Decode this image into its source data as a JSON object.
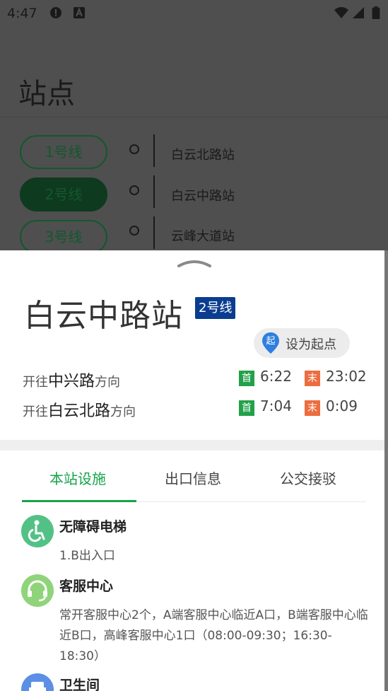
{
  "status_bar": {
    "time": "4:47"
  },
  "background": {
    "title": "站点",
    "lines": [
      {
        "label": "1号线",
        "active": false
      },
      {
        "label": "2号线",
        "active": true
      },
      {
        "label": "3号线",
        "active": false
      }
    ],
    "stations": [
      "白云北路站",
      "白云中路站",
      "云峰大道站"
    ]
  },
  "sheet": {
    "station_name": "白云中路站",
    "line_badge": "2号线",
    "set_start": {
      "pin": "起",
      "label": "设为起点"
    },
    "directions": [
      {
        "prefix": "开往",
        "dest": "中兴路",
        "suffix": "方向",
        "first_label": "首",
        "first_time": "6:22",
        "last_label": "末",
        "last_time": "23:02"
      },
      {
        "prefix": "开往",
        "dest": "白云北路",
        "suffix": "方向",
        "first_label": "首",
        "first_time": "7:04",
        "last_label": "末",
        "last_time": "0:09"
      }
    ],
    "tabs": [
      "本站设施",
      "出口信息",
      "公交接驳"
    ],
    "facilities": [
      {
        "title": "无障碍电梯",
        "desc": "1.B出入口",
        "icon": "wheelchair-icon",
        "color": "#53c185"
      },
      {
        "title": "客服中心",
        "desc": "常开客服中心2个，A端客服中心临近A口，B端客服中心临近B口，高峰客服中心1口（08:00-09:30；16:30-18:30）",
        "icon": "headset-icon",
        "color": "#8fd47a"
      },
      {
        "title": "卫生间",
        "desc": "",
        "icon": "toilet-icon",
        "color": "#5c8fe6"
      }
    ]
  },
  "colors": {
    "accent": "#16a34a",
    "badge": "#0a3d8f",
    "first": "#22a14a",
    "last": "#ec6d3f"
  }
}
